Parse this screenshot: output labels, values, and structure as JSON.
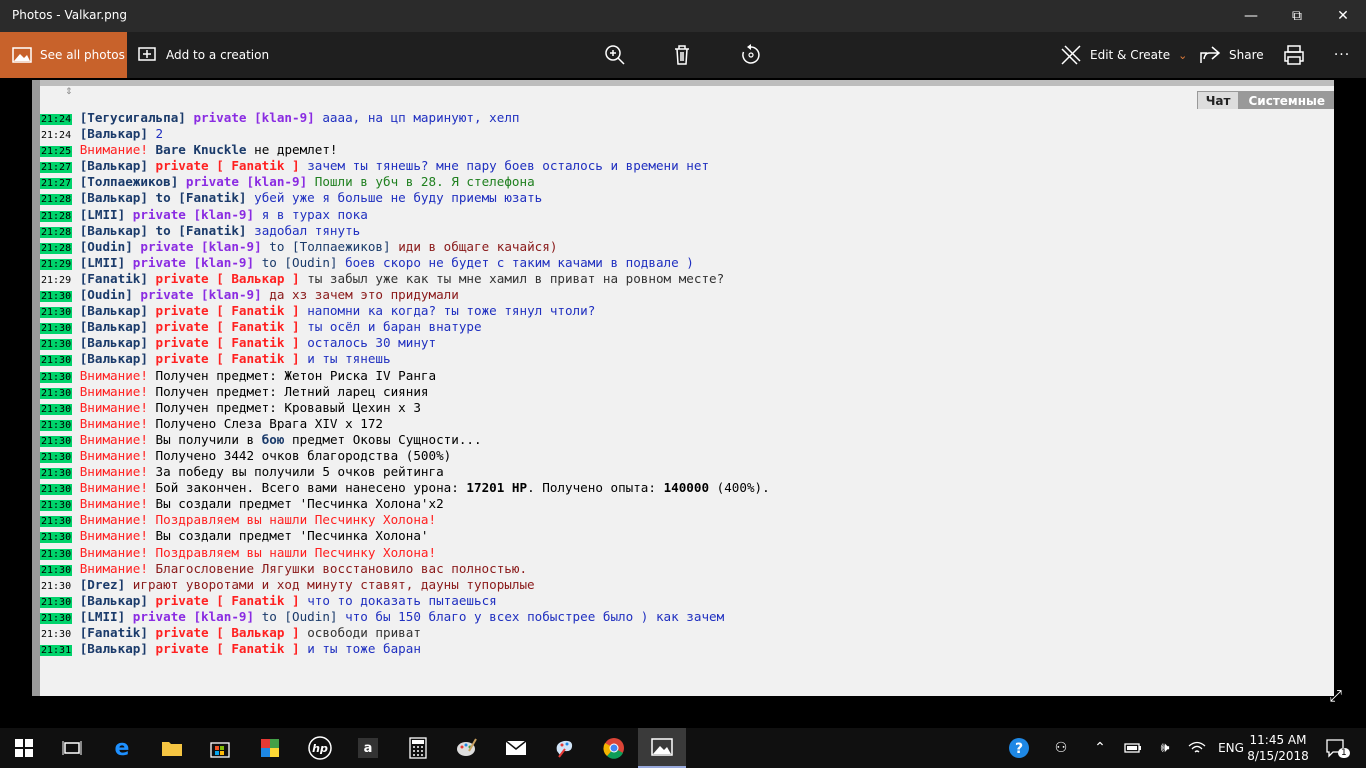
{
  "window": {
    "title": "Photos - Valkar.png",
    "minimize_glyph": "—",
    "maximize_glyph": "⧉",
    "close_glyph": "✕"
  },
  "toolbar": {
    "see_all": "See all photos",
    "add_to_creation": "Add to a creation",
    "edit_create": "Edit & Create",
    "share": "Share",
    "more": "···"
  },
  "chat": {
    "tab_chat": "Чат",
    "tab_system": "Системные",
    "lines": [
      {
        "time": "21:24",
        "hl": true,
        "segs": [
          [
            "[Тегусигальпа] ",
            "#1a3a6a",
            1
          ],
          [
            "private [klan-9] ",
            "#8a2be2",
            1
          ],
          [
            "аааа, на цп маринуют, хелп",
            "#2030c0",
            0
          ]
        ]
      },
      {
        "time": "21:24",
        "hl": false,
        "segs": [
          [
            "[Валькар] ",
            "#1a3a6a",
            1
          ],
          [
            "2",
            "#2030c0",
            0
          ]
        ]
      },
      {
        "time": "21:25",
        "hl": true,
        "segs": [
          [
            "Внимание! ",
            "#ff2020",
            0
          ],
          [
            "Bare Knuckle ",
            "#1a3a6a",
            1
          ],
          [
            "не дремлет!",
            "#000000",
            0
          ]
        ]
      },
      {
        "time": "21:27",
        "hl": true,
        "segs": [
          [
            "[Валькар] ",
            "#1a3a6a",
            1
          ],
          [
            "private [ Fanatik ] ",
            "#ff2020",
            1
          ],
          [
            "зачем ты тянешь? мне пару боев осталось и времени нет",
            "#2030c0",
            0
          ]
        ]
      },
      {
        "time": "21:27",
        "hl": true,
        "segs": [
          [
            "[Толпаежиков] ",
            "#1a3a6a",
            1
          ],
          [
            "private [klan-9] ",
            "#8a2be2",
            1
          ],
          [
            "Пошли в убч в 28. Я стелефона",
            "#208020",
            0
          ]
        ]
      },
      {
        "time": "21:28",
        "hl": true,
        "segs": [
          [
            "[Валькар] ",
            "#1a3a6a",
            1
          ],
          [
            "to [Fanatik] ",
            "#1a3a6a",
            1
          ],
          [
            "убей уже я больше не буду приемы юзать",
            "#2030c0",
            0
          ]
        ]
      },
      {
        "time": "21:28",
        "hl": true,
        "segs": [
          [
            "[LMII] ",
            "#1a3a6a",
            1
          ],
          [
            "private [klan-9] ",
            "#8a2be2",
            1
          ],
          [
            "я в турах пока",
            "#2030c0",
            0
          ]
        ]
      },
      {
        "time": "21:28",
        "hl": true,
        "segs": [
          [
            "[Валькар] ",
            "#1a3a6a",
            1
          ],
          [
            "to [Fanatik] ",
            "#1a3a6a",
            1
          ],
          [
            "задобал тянуть",
            "#2030c0",
            0
          ]
        ]
      },
      {
        "time": "21:28",
        "hl": true,
        "segs": [
          [
            "[Oudin] ",
            "#1a3a6a",
            1
          ],
          [
            "private [klan-9] ",
            "#8a2be2",
            1
          ],
          [
            "to [Толпаежиков] ",
            "#1a3a6a",
            0
          ],
          [
            "иди в общаге качайся)",
            "#8a1a1a",
            0
          ]
        ]
      },
      {
        "time": "21:29",
        "hl": true,
        "segs": [
          [
            "[LMII] ",
            "#1a3a6a",
            1
          ],
          [
            "private [klan-9] ",
            "#8a2be2",
            1
          ],
          [
            "to [Oudin] ",
            "#1a3a6a",
            0
          ],
          [
            "боев скоро не будет с таким качами в подвале )",
            "#2030c0",
            0
          ]
        ]
      },
      {
        "time": "21:29",
        "hl": false,
        "segs": [
          [
            "[Fanatik] ",
            "#1a3a6a",
            1
          ],
          [
            "private [ Валькар ] ",
            "#ff2020",
            1
          ],
          [
            "ты забыл уже как ты мне хамил в приват на ровном месте?",
            "#333333",
            0
          ]
        ]
      },
      {
        "time": "21:30",
        "hl": true,
        "segs": [
          [
            "[Oudin] ",
            "#1a3a6a",
            1
          ],
          [
            "private [klan-9] ",
            "#8a2be2",
            1
          ],
          [
            "да хз зачем это придумали",
            "#8a1a1a",
            0
          ]
        ]
      },
      {
        "time": "21:30",
        "hl": true,
        "segs": [
          [
            "[Валькар] ",
            "#1a3a6a",
            1
          ],
          [
            "private [ Fanatik ] ",
            "#ff2020",
            1
          ],
          [
            "напомни ка когда? ты тоже тянул чтоли?",
            "#2030c0",
            0
          ]
        ]
      },
      {
        "time": "21:30",
        "hl": true,
        "segs": [
          [
            "[Валькар] ",
            "#1a3a6a",
            1
          ],
          [
            "private [ Fanatik ] ",
            "#ff2020",
            1
          ],
          [
            "ты осёл и баран внатуре",
            "#2030c0",
            0
          ]
        ]
      },
      {
        "time": "21:30",
        "hl": true,
        "segs": [
          [
            "[Валькар] ",
            "#1a3a6a",
            1
          ],
          [
            "private [ Fanatik ] ",
            "#ff2020",
            1
          ],
          [
            "осталось 30 минут",
            "#2030c0",
            0
          ]
        ]
      },
      {
        "time": "21:30",
        "hl": true,
        "segs": [
          [
            "[Валькар] ",
            "#1a3a6a",
            1
          ],
          [
            "private [ Fanatik ] ",
            "#ff2020",
            1
          ],
          [
            "и ты тянешь",
            "#2030c0",
            0
          ]
        ]
      },
      {
        "time": "21:30",
        "hl": true,
        "segs": [
          [
            "Внимание! ",
            "#ff2020",
            0
          ],
          [
            "Получен предмет: Жетон Риска IV Ранга",
            "#000000",
            0
          ]
        ]
      },
      {
        "time": "21:30",
        "hl": true,
        "segs": [
          [
            "Внимание! ",
            "#ff2020",
            0
          ],
          [
            "Получен предмет: Летний ларец сияния",
            "#000000",
            0
          ]
        ]
      },
      {
        "time": "21:30",
        "hl": true,
        "segs": [
          [
            "Внимание! ",
            "#ff2020",
            0
          ],
          [
            "Получен предмет: Кровавый Цехин x 3",
            "#000000",
            0
          ]
        ]
      },
      {
        "time": "21:30",
        "hl": true,
        "segs": [
          [
            "Внимание! ",
            "#ff2020",
            0
          ],
          [
            "Получено Слеза Врага XIV x 172",
            "#000000",
            0
          ]
        ]
      },
      {
        "time": "21:30",
        "hl": true,
        "segs": [
          [
            "Внимание! ",
            "#ff2020",
            0
          ],
          [
            "Вы получили в ",
            "#000000",
            0
          ],
          [
            "бою ",
            "#1a3a6a",
            1
          ],
          [
            "предмет Оковы Сущности...",
            "#000000",
            0
          ]
        ]
      },
      {
        "time": "21:30",
        "hl": true,
        "segs": [
          [
            "Внимание! ",
            "#ff2020",
            0
          ],
          [
            "Получено 3442 очков благородства (500%)",
            "#000000",
            0
          ]
        ]
      },
      {
        "time": "21:30",
        "hl": true,
        "segs": [
          [
            "Внимание! ",
            "#ff2020",
            0
          ],
          [
            "За победу вы получили 5 очков рейтинга",
            "#000000",
            0
          ]
        ]
      },
      {
        "time": "21:30",
        "hl": true,
        "segs": [
          [
            "Внимание! ",
            "#ff2020",
            0
          ],
          [
            "Бой закончен. Всего вами нанесено урона: ",
            "#000000",
            0
          ],
          [
            "17201 HP",
            "#000000",
            1
          ],
          [
            ". Получено опыта: ",
            "#000000",
            0
          ],
          [
            "140000",
            "#000000",
            1
          ],
          [
            " (400%).",
            "#000000",
            0
          ]
        ]
      },
      {
        "time": "21:30",
        "hl": true,
        "segs": [
          [
            "Внимание! ",
            "#ff2020",
            0
          ],
          [
            "Вы создали предмет 'Песчинка Холона'x2",
            "#000000",
            0
          ]
        ]
      },
      {
        "time": "21:30",
        "hl": true,
        "segs": [
          [
            "Внимание! ",
            "#ff2020",
            0
          ],
          [
            "Поздравляем вы нашли Песчинку Холона!",
            "#ff2020",
            0
          ]
        ]
      },
      {
        "time": "21:30",
        "hl": true,
        "segs": [
          [
            "Внимание! ",
            "#ff2020",
            0
          ],
          [
            "Вы создали предмет 'Песчинка Холона'",
            "#000000",
            0
          ]
        ]
      },
      {
        "time": "21:30",
        "hl": true,
        "segs": [
          [
            "Внимание! ",
            "#ff2020",
            0
          ],
          [
            "Поздравляем вы нашли Песчинку Холона!",
            "#ff2020",
            0
          ]
        ]
      },
      {
        "time": "21:30",
        "hl": true,
        "segs": [
          [
            "Внимание! ",
            "#ff2020",
            0
          ],
          [
            "Благословение Лягушки восстановило вас полностью.",
            "#8a1a1a",
            0
          ]
        ]
      },
      {
        "time": "21:30",
        "hl": false,
        "segs": [
          [
            "[Drez] ",
            "#1a3a6a",
            1
          ],
          [
            "играют уворотами и ход минуту ставят, дауны тупорылые",
            "#8a1a1a",
            0
          ]
        ]
      },
      {
        "time": "21:30",
        "hl": true,
        "segs": [
          [
            "[Валькар] ",
            "#1a3a6a",
            1
          ],
          [
            "private [ Fanatik ] ",
            "#ff2020",
            1
          ],
          [
            "что то доказать пытаешься",
            "#2030c0",
            0
          ]
        ]
      },
      {
        "time": "21:30",
        "hl": true,
        "segs": [
          [
            "[LMII] ",
            "#1a3a6a",
            1
          ],
          [
            "private [klan-9] ",
            "#8a2be2",
            1
          ],
          [
            "to [Oudin] ",
            "#1a3a6a",
            0
          ],
          [
            "что бы 150 благо у всех побыстрее было ) как зачем",
            "#2030c0",
            0
          ]
        ]
      },
      {
        "time": "21:30",
        "hl": false,
        "segs": [
          [
            "[Fanatik] ",
            "#1a3a6a",
            1
          ],
          [
            "private [ Валькар ] ",
            "#ff2020",
            1
          ],
          [
            "освободи приват",
            "#333333",
            0
          ]
        ]
      },
      {
        "time": "21:31",
        "hl": true,
        "segs": [
          [
            "[Валькар] ",
            "#1a3a6a",
            1
          ],
          [
            "private [ Fanatik ] ",
            "#ff2020",
            1
          ],
          [
            "и ты тоже баран",
            "#2030c0",
            0
          ]
        ]
      }
    ]
  },
  "taskbar": {
    "clock_time": "11:45 AM",
    "clock_date": "8/15/2018",
    "language": "ENG",
    "notification_count": "1"
  },
  "colors": {
    "accent": "#c8622b",
    "timestamp_highlight": "#00d36b"
  }
}
